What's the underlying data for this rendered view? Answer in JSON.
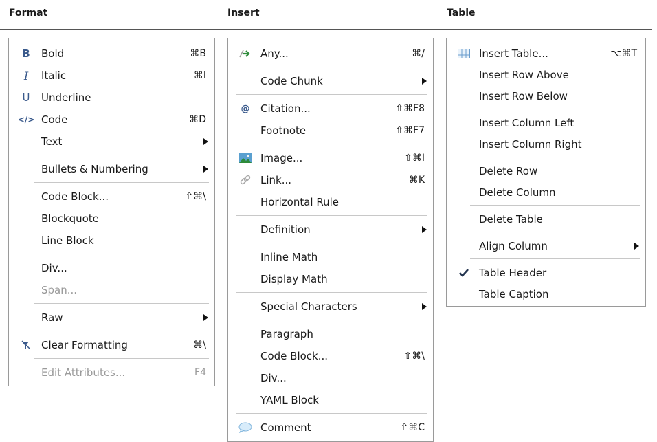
{
  "headers": {
    "format": "Format",
    "insert": "Insert",
    "table": "Table"
  },
  "format_menu": {
    "bold": {
      "label": "Bold",
      "shortcut": "⌘B",
      "icon": "bold-icon"
    },
    "italic": {
      "label": "Italic",
      "shortcut": "⌘I",
      "icon": "italic-icon"
    },
    "underline": {
      "label": "Underline",
      "icon": "underline-icon"
    },
    "code": {
      "label": "Code",
      "shortcut": "⌘D",
      "icon": "code-icon"
    },
    "text": {
      "label": "Text"
    },
    "bullets": {
      "label": "Bullets & Numbering"
    },
    "code_block": {
      "label": "Code Block...",
      "shortcut": "⇧⌘\\"
    },
    "blockquote": {
      "label": "Blockquote"
    },
    "line_block": {
      "label": "Line Block"
    },
    "div": {
      "label": "Div..."
    },
    "span": {
      "label": "Span..."
    },
    "raw": {
      "label": "Raw"
    },
    "clear_formatting": {
      "label": "Clear Formatting",
      "shortcut": "⌘\\",
      "icon": "clear-formatting-icon"
    },
    "edit_attributes": {
      "label": "Edit Attributes...",
      "shortcut": "F4"
    }
  },
  "insert_menu": {
    "any": {
      "label": "Any...",
      "shortcut": "⌘/",
      "icon": "any-icon"
    },
    "code_chunk": {
      "label": "Code Chunk"
    },
    "citation": {
      "label": "Citation...",
      "shortcut": "⇧⌘F8",
      "icon": "at-icon"
    },
    "footnote": {
      "label": "Footnote",
      "shortcut": "⇧⌘F7"
    },
    "image": {
      "label": "Image...",
      "shortcut": "⇧⌘I",
      "icon": "image-icon"
    },
    "link": {
      "label": "Link...",
      "shortcut": "⌘K",
      "icon": "link-icon"
    },
    "horizontal_rule": {
      "label": "Horizontal Rule"
    },
    "definition": {
      "label": "Definition"
    },
    "inline_math": {
      "label": "Inline Math"
    },
    "display_math": {
      "label": "Display Math"
    },
    "special_characters": {
      "label": "Special Characters"
    },
    "paragraph": {
      "label": "Paragraph"
    },
    "code_block": {
      "label": "Code Block...",
      "shortcut": "⇧⌘\\"
    },
    "div": {
      "label": "Div..."
    },
    "yaml_block": {
      "label": "YAML Block"
    },
    "comment": {
      "label": "Comment",
      "shortcut": "⇧⌘C",
      "icon": "comment-icon"
    }
  },
  "table_menu": {
    "insert_table": {
      "label": "Insert Table...",
      "shortcut": "⌥⌘T",
      "icon": "table-icon"
    },
    "insert_row_above": {
      "label": "Insert Row Above"
    },
    "insert_row_below": {
      "label": "Insert Row Below"
    },
    "insert_column_left": {
      "label": "Insert Column Left"
    },
    "insert_column_right": {
      "label": "Insert Column Right"
    },
    "delete_row": {
      "label": "Delete Row"
    },
    "delete_column": {
      "label": "Delete Column"
    },
    "delete_table": {
      "label": "Delete Table"
    },
    "align_column": {
      "label": "Align Column"
    },
    "table_header": {
      "label": "Table Header",
      "checked": true,
      "icon": "checkmark-icon"
    },
    "table_caption": {
      "label": "Table Caption"
    }
  },
  "colors": {
    "accent": "#2e8b3a",
    "icon_blue": "#3a5a8c",
    "disabled": "#9a9a9a"
  }
}
